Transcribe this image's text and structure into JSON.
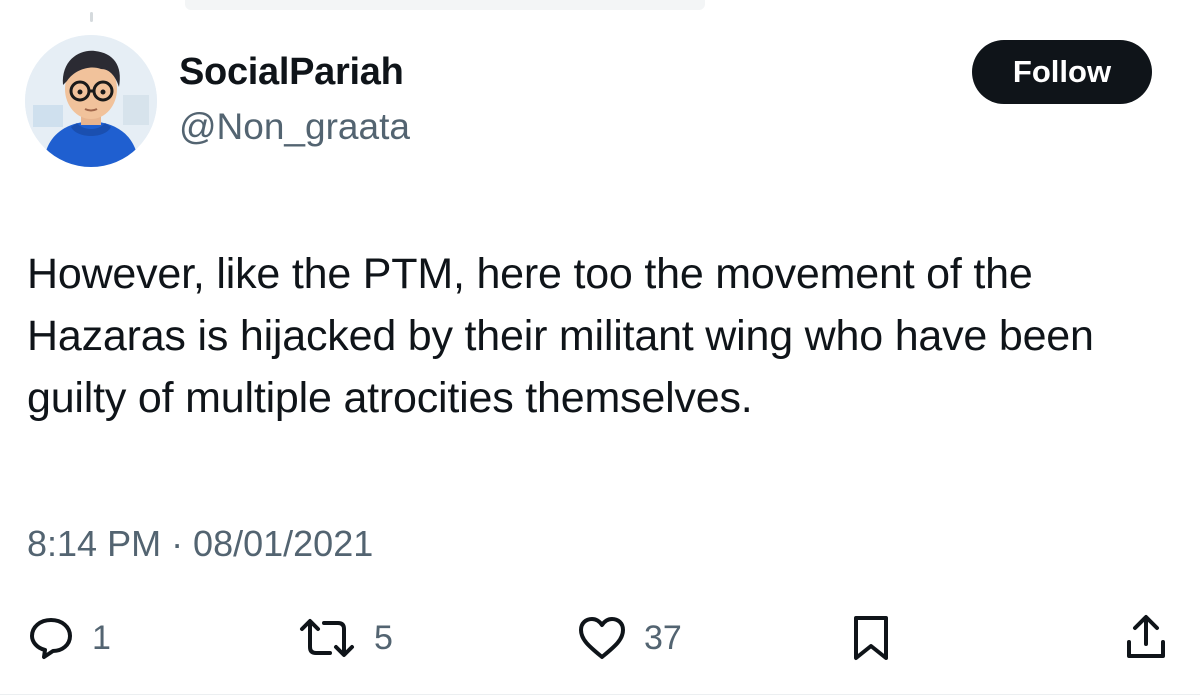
{
  "author": {
    "display_name": "SocialPariah",
    "handle": "@Non_graata"
  },
  "follow_button": {
    "label": "Follow"
  },
  "tweet": {
    "text": "However, like the PTM, here too the movement of the Hazaras is hijacked by their militant wing who have been guilty of multiple atrocities themselves.",
    "timestamp": "8:14 PM · 08/01/2021"
  },
  "actions": {
    "reply": {
      "icon": "reply-icon",
      "count": "1"
    },
    "retweet": {
      "icon": "retweet-icon",
      "count": "5"
    },
    "like": {
      "icon": "heart-icon",
      "count": "37"
    },
    "bookmark": {
      "icon": "bookmark-icon"
    },
    "share": {
      "icon": "share-icon"
    }
  },
  "colors": {
    "text_primary": "#0f1419",
    "text_secondary": "#536471",
    "button_bg": "#0f1419",
    "button_text": "#ffffff"
  }
}
